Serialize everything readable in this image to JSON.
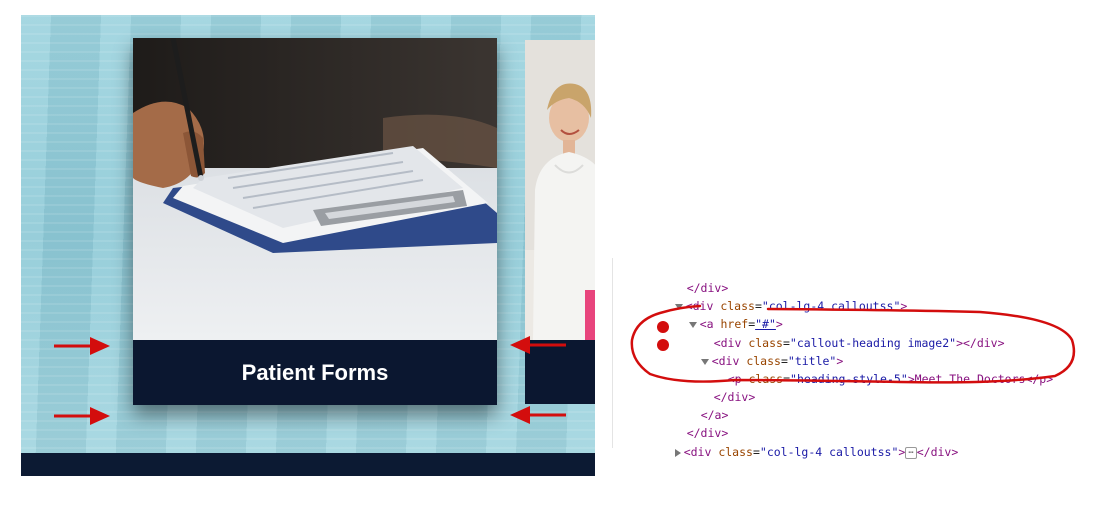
{
  "website": {
    "card_title": "Patient Forms"
  },
  "devtools": {
    "line1": "</div>",
    "line2_tag_open": "<div ",
    "line2_attr": "class",
    "line2_val": "\"col-lg-4 calloutss\"",
    "line2_close": ">",
    "line3_tag_open": "<a ",
    "line3_attr": "href",
    "line3_val": "\"#\"",
    "line3_close": ">",
    "line4_tag_open": "<div ",
    "line4_attr": "class",
    "line4_val": "\"callout-heading image2\"",
    "line4_close": "></div>",
    "line5_tag_open": "<div ",
    "line5_attr": "class",
    "line5_val": "\"title\"",
    "line5_close": ">",
    "line6_tag_open": "<p ",
    "line6_attr": "class",
    "line6_val": "\"heading-style-5\"",
    "line6_text": ">Meet The Doctors</p>",
    "line7": "</div>",
    "line8": "</a>",
    "line9": "</div>",
    "line10_tag_open": "<div ",
    "line10_attr": "class",
    "line10_val": "\"col-lg-4 calloutss\"",
    "line10_mid": ">",
    "line10_ellipsis": "⋯",
    "line10_close": "</div>"
  },
  "colors": {
    "annotation_red": "#d30d0d",
    "card_navy": "#0b1730"
  }
}
